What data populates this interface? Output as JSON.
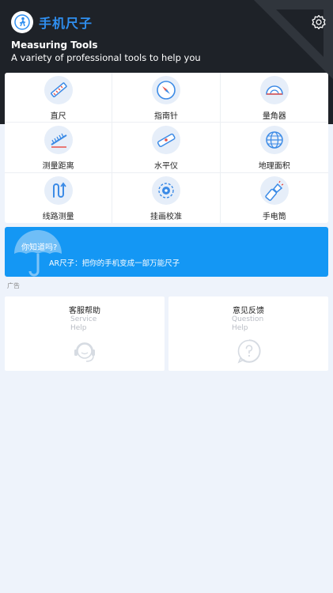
{
  "header": {
    "app_title": "手机尺子",
    "title": "Measuring Tools",
    "subtitle": "A variety of professional tools to help you",
    "logo_icon": "ruler-person-logo-icon",
    "settings_icon": "gear-icon"
  },
  "tools": [
    {
      "label": "直尺",
      "icon": "ruler-icon"
    },
    {
      "label": "指南针",
      "icon": "compass-icon"
    },
    {
      "label": "量角器",
      "icon": "protractor-icon"
    },
    {
      "label": "测量距离",
      "icon": "distance-ruler-icon"
    },
    {
      "label": "水平仪",
      "icon": "spirit-level-icon"
    },
    {
      "label": "地理面积",
      "icon": "globe-icon"
    },
    {
      "label": "线路测量",
      "icon": "route-icon"
    },
    {
      "label": "挂画校准",
      "icon": "target-icon"
    },
    {
      "label": "手电筒",
      "icon": "flashlight-icon"
    }
  ],
  "banner": {
    "question": "你知道吗?",
    "text": "AR尺子：把你的手机变成一部万能尺子",
    "icon": "umbrella-icon"
  },
  "ad_label": "广告",
  "cards": [
    {
      "title": "客服帮助",
      "en_line1": "Service",
      "en_line2": "Help",
      "icon": "headset-icon"
    },
    {
      "title": "意见反馈",
      "en_line1": "Question",
      "en_line2": "Help",
      "icon": "question-icon"
    }
  ],
  "colors": {
    "header_bg": "#1e2228",
    "accent": "#2f8ff0",
    "banner_bg": "#1497f4",
    "page_bg": "#eef3fb"
  }
}
